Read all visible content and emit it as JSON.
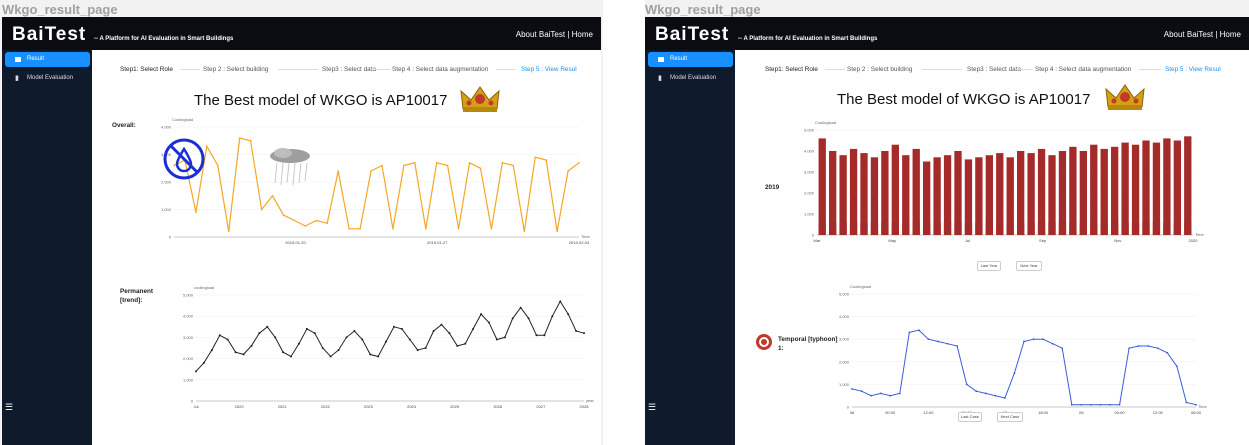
{
  "window_title": "Wkgo_result_page",
  "app": {
    "logo": "BaiTest",
    "tagline": "-- A Platform for AI Evaluation in Smart Buildings",
    "about_link": "About BaiTest",
    "separator": "|",
    "home_link": "Home"
  },
  "sidebar": {
    "items": [
      {
        "label": "Result",
        "icon": "envelope-icon"
      },
      {
        "label": "Model Evaluation",
        "icon": "bar-chart-icon"
      }
    ],
    "menu_icon": "☰"
  },
  "steps": [
    "Step1: Select Role",
    "Step 2 : Select building",
    "Step3 : Select data",
    "Step 4 : Select data augmentation",
    "Step 5 : View Resul"
  ],
  "headline": "The Best model of WKGO is AP10017",
  "colors": {
    "topbar": "#0a0c12",
    "sidebar": "#0f1a2d",
    "active": "#1890ff",
    "orange": "#f5a623",
    "red": "#a52a2a",
    "blue": "#3b5bdb",
    "black": "#222222"
  },
  "left": {
    "overall_label": "Overall:",
    "overall_chart": {
      "type": "line",
      "ylabel": "Coolingload",
      "ylim": [
        0,
        4000
      ],
      "yticks": [
        "0",
        "1,000",
        "2,000",
        "3,000",
        "4,000"
      ],
      "xticks": [
        "2019-01-20",
        "2019-01-27",
        "2019-02-03"
      ],
      "xend": "Time",
      "series": [
        {
          "values": [
            2600,
            2800,
            900,
            3300,
            2600,
            200,
            3600,
            3500,
            1000,
            1500,
            800,
            600,
            400,
            600,
            500,
            2400,
            300,
            300,
            2400,
            2600,
            300,
            2600,
            2700,
            300,
            2700,
            2600,
            300,
            2700,
            2500,
            300,
            2700,
            2600,
            200,
            2900,
            2800,
            200,
            2400,
            2700
          ]
        }
      ]
    },
    "overall_icons": [
      "no-water-icon",
      "rain-cloud-icon"
    ],
    "trend_label_1": "Permanent",
    "trend_label_2": "[trend]:",
    "trend_chart": {
      "type": "line",
      "ylabel": "coolingload",
      "ylim": [
        0,
        5000
      ],
      "yticks": [
        "0",
        "1,000",
        "2,000",
        "3,000",
        "4,000",
        "5,000"
      ],
      "xticks": [
        "Jul",
        "2020",
        "2021",
        "2022",
        "2023",
        "2024",
        "2025",
        "2026",
        "2027",
        "2028"
      ],
      "xend": "year",
      "series": [
        {
          "values": [
            1400,
            1800,
            2400,
            3100,
            2900,
            2300,
            2200,
            2600,
            3200,
            3500,
            3000,
            2300,
            2100,
            2700,
            3400,
            3200,
            2500,
            2100,
            2400,
            3000,
            3300,
            2900,
            2200,
            2100,
            2800,
            3500,
            3400,
            2900,
            2400,
            2500,
            3300,
            3600,
            3200,
            2600,
            2700,
            3400,
            4100,
            3700,
            2900,
            3000,
            3900,
            4400,
            3900,
            3100,
            3100,
            4000,
            4700,
            4100,
            3300,
            3200
          ]
        }
      ]
    }
  },
  "right": {
    "year_label": "2019",
    "year_chart": {
      "type": "bar",
      "ylabel": "Coolingload",
      "ylim": [
        0,
        5000
      ],
      "yticks": [
        "0",
        "1,000",
        "2,000",
        "3,000",
        "4,000",
        "5,000"
      ],
      "xticks": [
        "Mar",
        "May",
        "Jul",
        "Sep",
        "Nov",
        "2020"
      ],
      "xend": "Time",
      "series": [
        {
          "values": [
            4600,
            4000,
            3800,
            4100,
            3900,
            3700,
            4000,
            4300,
            3800,
            4100,
            3500,
            3700,
            3800,
            4000,
            3600,
            3700,
            3800,
            3900,
            3700,
            4000,
            3900,
            4100,
            3800,
            4000,
            4200,
            4000,
            4300,
            4100,
            4200,
            4400,
            4300,
            4500,
            4400,
            4600,
            4500,
            4700
          ]
        }
      ]
    },
    "year_buttons": [
      "Last Year",
      "Next Year"
    ],
    "temporal_label_1": "Temporal [typhoon]",
    "temporal_label_2": "1:",
    "temporal_icon": "typhoon-icon",
    "temporal_chart": {
      "type": "line",
      "ylabel": "Coolingload",
      "ylim": [
        0,
        5000
      ],
      "yticks": [
        "0",
        "1,000",
        "2,000",
        "3,000",
        "4,000",
        "5,000"
      ],
      "xticks": [
        "06",
        "00:00",
        "12:00",
        "06:00",
        "12",
        "18:00",
        "06",
        "00:00",
        "12:00",
        "06:00"
      ],
      "xend": "Time",
      "series": [
        {
          "values": [
            800,
            700,
            500,
            600,
            500,
            600,
            3300,
            3400,
            3000,
            2900,
            2800,
            2700,
            1000,
            700,
            600,
            500,
            400,
            1500,
            2900,
            3000,
            3000,
            2800,
            2600,
            100,
            100,
            100,
            100,
            100,
            100,
            2600,
            2700,
            2700,
            2600,
            2400,
            1800,
            200,
            100
          ]
        }
      ]
    },
    "day_buttons": [
      "Last Case",
      "Next Case"
    ]
  }
}
